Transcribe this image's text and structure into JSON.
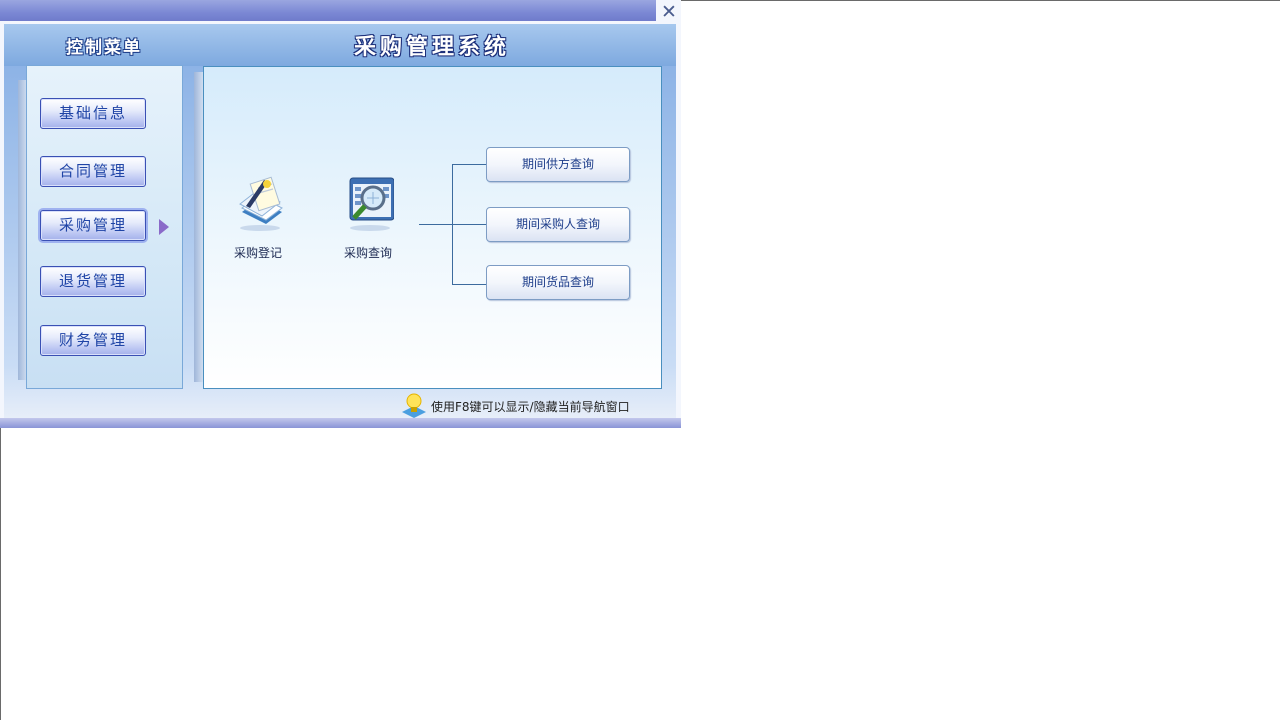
{
  "window": {
    "close_symbol": "✕"
  },
  "header": {
    "menu_title": "控制菜单",
    "system_title": "采购管理系统"
  },
  "menu": {
    "items": [
      {
        "label": "基础信息"
      },
      {
        "label": "合同管理"
      },
      {
        "label": "采购管理",
        "active": true
      },
      {
        "label": "退货管理"
      },
      {
        "label": "财务管理"
      }
    ]
  },
  "content": {
    "icons": [
      {
        "label": "采购登记",
        "icon": "notepad-pen-icon"
      },
      {
        "label": "采购查询",
        "icon": "magnifier-report-icon"
      }
    ],
    "queries": [
      {
        "label": "期间供方查询"
      },
      {
        "label": "期间采购人查询"
      },
      {
        "label": "期间货品查询"
      }
    ]
  },
  "footer": {
    "hint": "使用F8键可以显示/隐藏当前导航窗口",
    "hint_icon": "lightbulb-icon"
  },
  "colors": {
    "titlebar": "#7b88d4",
    "header": "#7ea9df",
    "button_text": "#1f44a6",
    "tree_line": "#3c6b9e"
  }
}
